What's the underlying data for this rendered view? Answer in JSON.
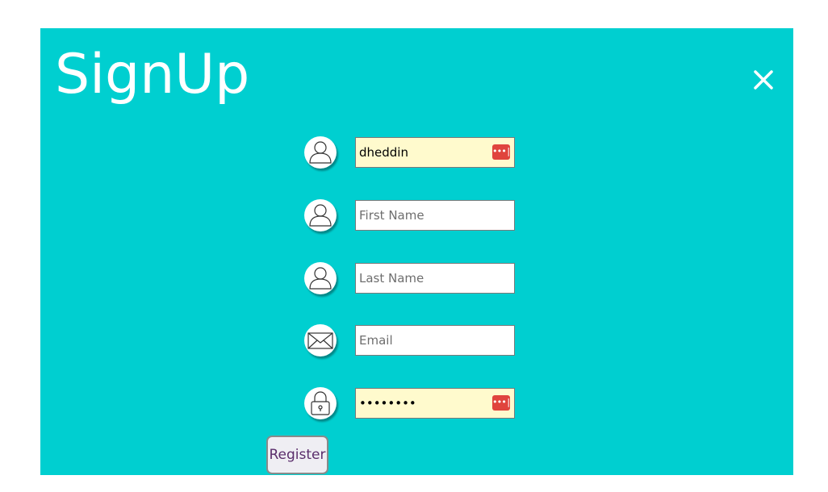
{
  "dialog": {
    "title": "SignUp",
    "close_icon": "close-icon",
    "background_color": "#00cfd0"
  },
  "form": {
    "username": {
      "value": "dheddin",
      "icon": "user-icon"
    },
    "first_name": {
      "placeholder": "First Name",
      "value": "",
      "icon": "user-icon"
    },
    "last_name": {
      "placeholder": "Last Name",
      "value": "",
      "icon": "user-icon"
    },
    "email": {
      "placeholder": "Email",
      "value": "",
      "icon": "envelope-icon"
    },
    "password": {
      "value": "••••••••",
      "icon": "lock-icon"
    },
    "password_manager_glyph": "•••|",
    "register_label": "Register"
  }
}
